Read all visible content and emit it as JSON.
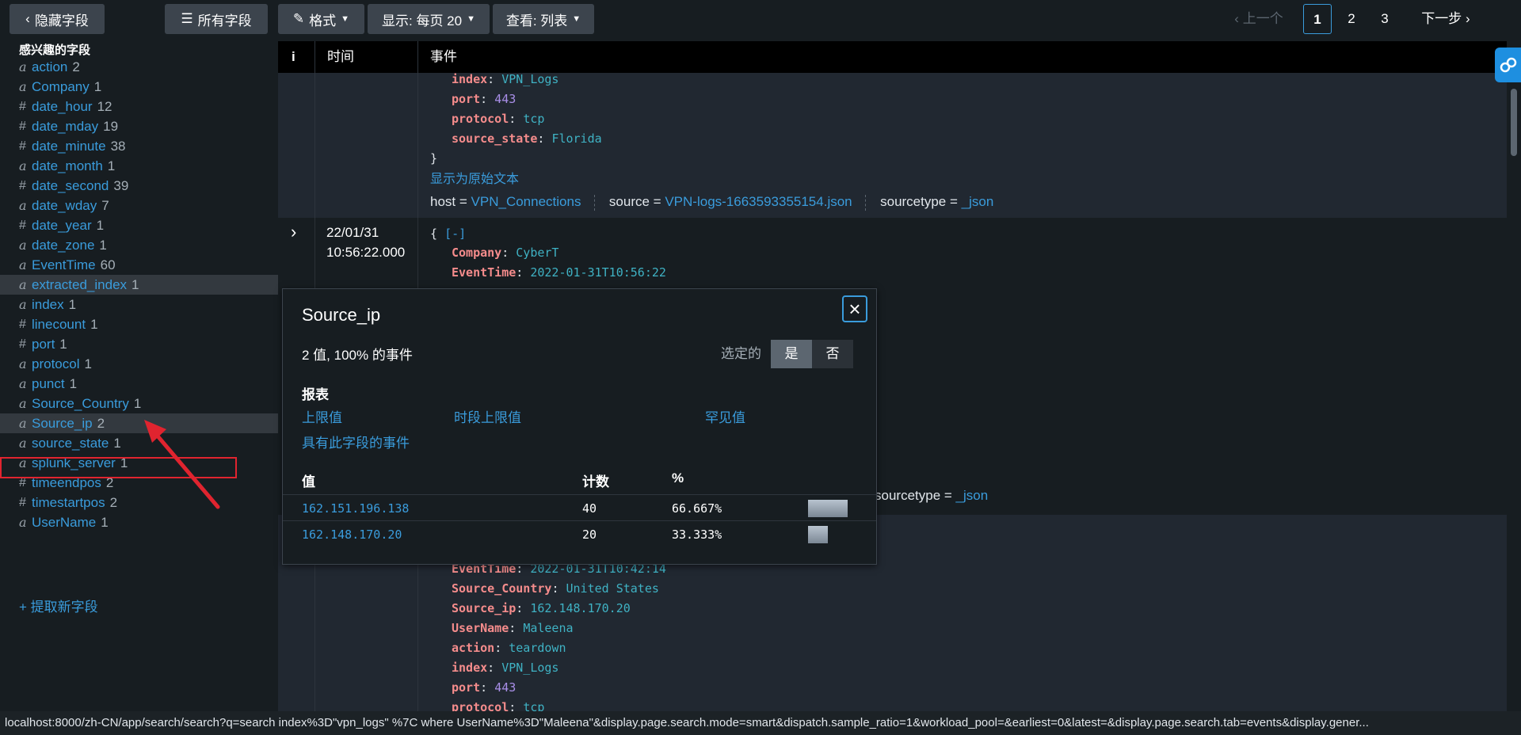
{
  "toolbar": {
    "hide_fields": "隐藏字段",
    "all_fields": "所有字段",
    "format": "格式",
    "display": "显示: 每页 20",
    "view": "查看: 列表"
  },
  "pagination": {
    "prev": "上一个",
    "pages": [
      "1",
      "2",
      "3"
    ],
    "current": "1",
    "next": "下一步"
  },
  "sidebar": {
    "title": "感兴趣的字段",
    "fields": [
      {
        "type": "a",
        "name": "action",
        "count": "2"
      },
      {
        "type": "a",
        "name": "Company",
        "count": "1"
      },
      {
        "type": "#",
        "name": "date_hour",
        "count": "12"
      },
      {
        "type": "#",
        "name": "date_mday",
        "count": "19"
      },
      {
        "type": "#",
        "name": "date_minute",
        "count": "38"
      },
      {
        "type": "a",
        "name": "date_month",
        "count": "1"
      },
      {
        "type": "#",
        "name": "date_second",
        "count": "39"
      },
      {
        "type": "a",
        "name": "date_wday",
        "count": "7"
      },
      {
        "type": "#",
        "name": "date_year",
        "count": "1"
      },
      {
        "type": "a",
        "name": "date_zone",
        "count": "1"
      },
      {
        "type": "a",
        "name": "EventTime",
        "count": "60"
      },
      {
        "type": "a",
        "name": "extracted_index",
        "count": "1"
      },
      {
        "type": "a",
        "name": "index",
        "count": "1"
      },
      {
        "type": "#",
        "name": "linecount",
        "count": "1"
      },
      {
        "type": "#",
        "name": "port",
        "count": "1"
      },
      {
        "type": "a",
        "name": "protocol",
        "count": "1"
      },
      {
        "type": "a",
        "name": "punct",
        "count": "1"
      },
      {
        "type": "a",
        "name": "Source_Country",
        "count": "1"
      },
      {
        "type": "a",
        "name": "Source_ip",
        "count": "2"
      },
      {
        "type": "a",
        "name": "source_state",
        "count": "1"
      },
      {
        "type": "a",
        "name": "splunk_server",
        "count": "1"
      },
      {
        "type": "#",
        "name": "timeendpos",
        "count": "2"
      },
      {
        "type": "#",
        "name": "timestartpos",
        "count": "2"
      },
      {
        "type": "a",
        "name": "UserName",
        "count": "1"
      }
    ],
    "extract_new": "+ 提取新字段"
  },
  "table": {
    "col_info": "i",
    "col_time": "时间",
    "col_event": "事件"
  },
  "event1": {
    "lines": [
      {
        "key": "index",
        "val": "VPN_Logs",
        "kind": "str"
      },
      {
        "key": "port",
        "val": "443",
        "kind": "num"
      },
      {
        "key": "protocol",
        "val": "tcp",
        "kind": "str"
      },
      {
        "key": "source_state",
        "val": "Florida",
        "kind": "str"
      }
    ],
    "close_brace": "}",
    "show_raw": "显示为原始文本",
    "host_label": "host =",
    "host_val": "VPN_Connections",
    "source_label": "source =",
    "source_val": "VPN-logs-1663593355154.json",
    "sourcetype_label": "sourcetype =",
    "sourcetype_val": "_json"
  },
  "event2": {
    "date": "22/01/31",
    "time": "10:56:22.000",
    "open": "{",
    "collapse": "[-]",
    "lines": [
      {
        "key": "Company",
        "val": "CyberT",
        "kind": "str"
      },
      {
        "key": "EventTime",
        "val": "2022-01-31T10:56:22",
        "kind": "str"
      }
    ],
    "sourcetype_label": "sourcetype =",
    "sourcetype_val": "_json"
  },
  "event3": {
    "lines": [
      {
        "key": "EventTime",
        "val": "2022-01-31T10:42:14",
        "kind": "str"
      },
      {
        "key": "Source_Country",
        "val": "United States",
        "kind": "str"
      },
      {
        "key": "Source_ip",
        "val": "162.148.170.20",
        "kind": "str"
      },
      {
        "key": "UserName",
        "val": "Maleena",
        "kind": "str"
      },
      {
        "key": "action",
        "val": "teardown",
        "kind": "str"
      },
      {
        "key": "index",
        "val": "VPN_Logs",
        "kind": "str"
      },
      {
        "key": "port",
        "val": "443",
        "kind": "num"
      },
      {
        "key": "protocol",
        "val": "tcp",
        "kind": "str"
      }
    ]
  },
  "popup": {
    "title": "Source_ip",
    "summary": "2 值, 100% 的事件",
    "selected_label": "选定的",
    "yes": "是",
    "no": "否",
    "reports_label": "报表",
    "top_values": "上限值",
    "top_values_by_time": "时段上限值",
    "rare_values": "罕见值",
    "events_with_field": "具有此字段的事件",
    "col_value": "值",
    "col_count": "计数",
    "col_pct": "%",
    "rows": [
      {
        "value": "162.151.196.138",
        "count": "40",
        "pct": "66.667%",
        "fraction": 0.66667
      },
      {
        "value": "162.148.170.20",
        "count": "20",
        "pct": "33.333%",
        "fraction": 0.33333
      }
    ]
  },
  "status_url": "localhost:8000/zh-CN/app/search/search?q=search index%3D\"vpn_logs\" %7C where UserName%3D\"Maleena\"&display.page.search.mode=smart&dispatch.sample_ratio=1&workload_pool=&earliest=0&latest=&display.page.search.tab=events&display.gener...",
  "colors": {
    "accent": "#3a9cdc",
    "highlight_box": "#e0242f",
    "arrow": "#e0242f"
  }
}
